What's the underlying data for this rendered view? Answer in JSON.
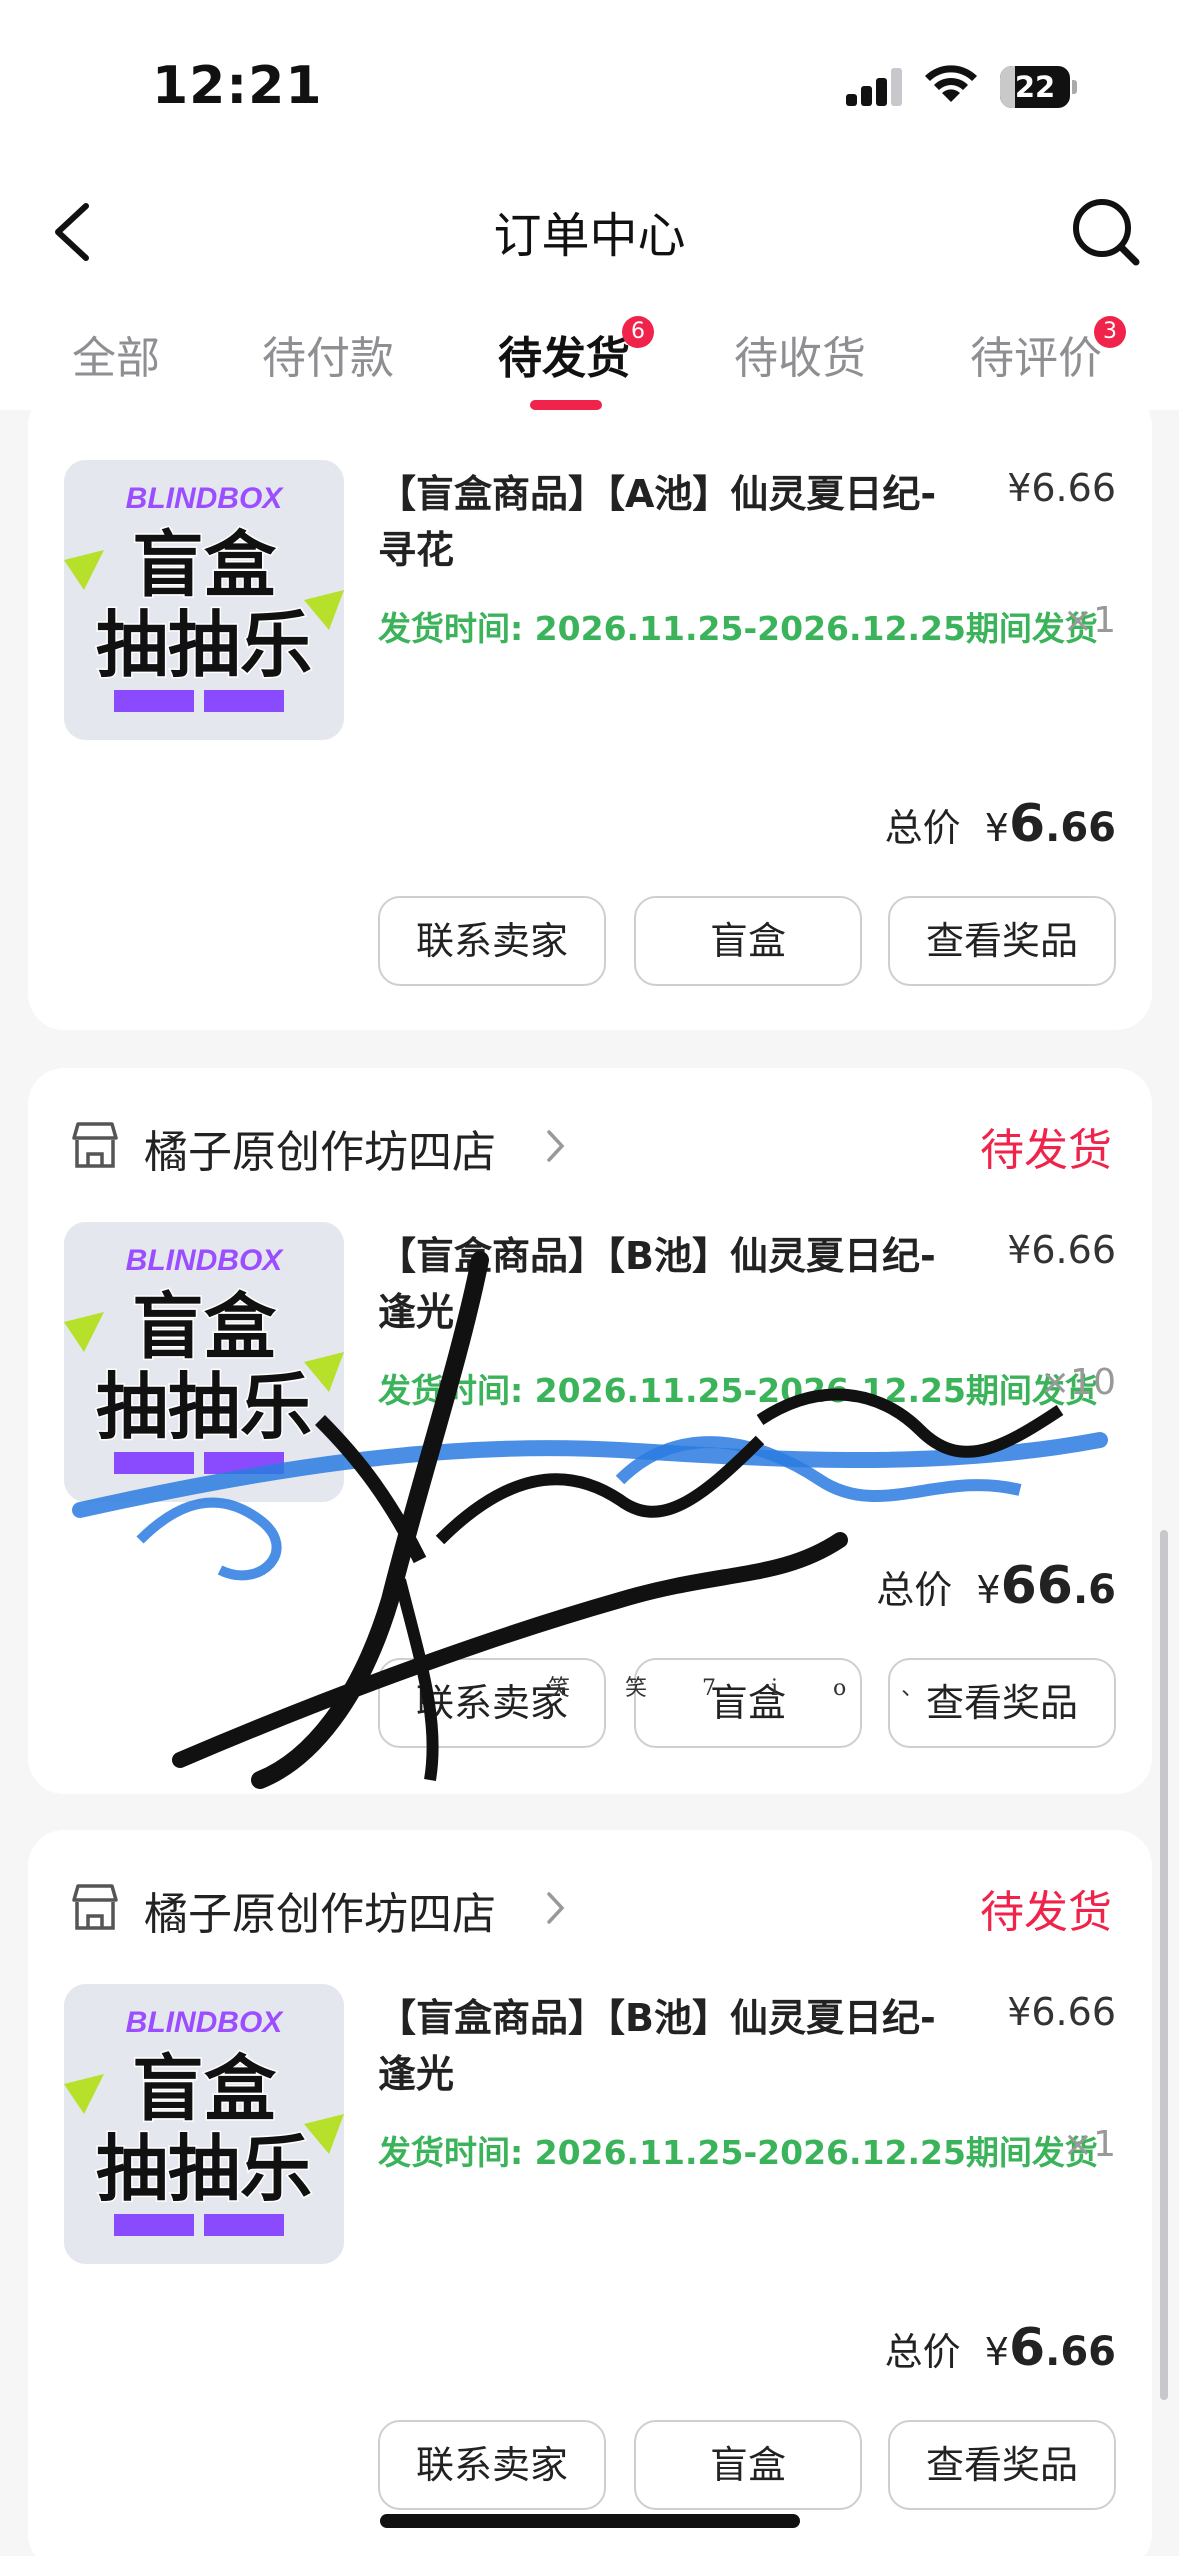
{
  "status_bar": {
    "time": "12:21",
    "battery": "22",
    "battery_fraction": 0.22
  },
  "nav": {
    "title": "订单中心",
    "back_icon": "chevron-left-icon",
    "search_icon": "search-icon"
  },
  "tabs": [
    {
      "label": "全部"
    },
    {
      "label": "待付款"
    },
    {
      "label": "待发货",
      "badge": "6",
      "active": true
    },
    {
      "label": "待收货"
    },
    {
      "label": "待评价",
      "badge": "3"
    }
  ],
  "colors": {
    "accent": "#f0234b",
    "ship_green": "#3bb35a",
    "background": "#f6f6f7"
  },
  "orders": [
    {
      "shop": "",
      "status": "",
      "product": {
        "image_text_top": "BLINDBOX",
        "image_text_main": "盲盒",
        "image_text_sub": "抽抽乐",
        "title": "【盲盒商品】【A池】仙灵夏日纪-寻花",
        "price": "¥6.66",
        "ship_time": "发货时间: 2026.11.25-2026.12.25期间发货",
        "qty": "×1"
      },
      "total_label": "总价",
      "total_currency": "¥",
      "total_int": "6",
      "total_dec": ".66",
      "buttons": [
        "联系卖家",
        "盲盒",
        "查看奖品"
      ]
    },
    {
      "shop": "橘子原创作坊四店",
      "status": "待发货",
      "product": {
        "image_text_top": "BLINDBOX",
        "image_text_main": "盲盒",
        "image_text_sub": "抽抽乐",
        "title": "【盲盒商品】【B池】仙灵夏日纪-逢光",
        "price": "¥6.66",
        "ship_time": "发货时间: 2026.11.25-2026.12.25期间发货",
        "qty": "×10"
      },
      "total_label": "总价",
      "total_currency": "¥",
      "total_int": "66",
      "total_dec": ".6",
      "buttons": [
        "联系卖家",
        "盲盒",
        "查看奖品"
      ]
    },
    {
      "shop": "橘子原创作坊四店",
      "status": "待发货",
      "product": {
        "image_text_top": "BLINDBOX",
        "image_text_main": "盲盒",
        "image_text_sub": "抽抽乐",
        "title": "【盲盒商品】【B池】仙灵夏日纪-逢光",
        "price": "¥6.66",
        "ship_time": "发货时间: 2026.11.25-2026.12.25期间发货",
        "qty": "×1"
      },
      "total_label": "总价",
      "total_currency": "¥",
      "total_int": "6",
      "total_dec": ".66",
      "buttons": [
        "联系卖家",
        "盲盒",
        "查看奖品"
      ]
    }
  ],
  "watermark": {
    "caption": "笑 笑 7 i o 、"
  }
}
